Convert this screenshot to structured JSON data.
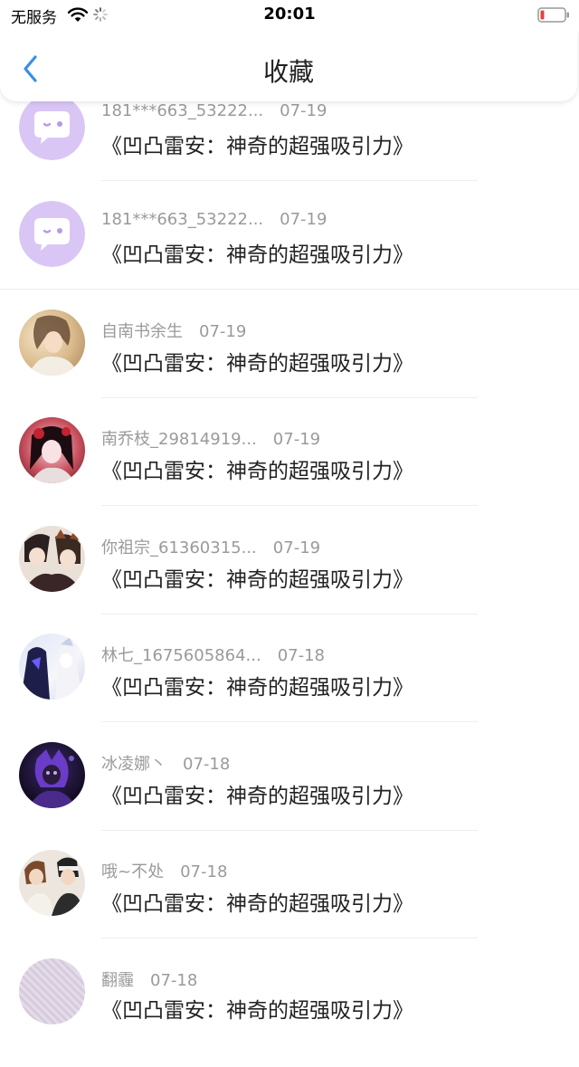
{
  "status_bar": {
    "carrier": "无服务",
    "time": "20:01"
  },
  "nav": {
    "title": "收藏"
  },
  "items": [
    {
      "username": "181***663_53222...",
      "date": "07-19",
      "content": "《凹凸雷安：神奇的超强吸引力》",
      "avatar_type": "default-bubble"
    },
    {
      "username": "181***663_53222...",
      "date": "07-19",
      "content": "《凹凸雷安：神奇的超强吸引力》",
      "avatar_type": "default-bubble"
    },
    {
      "username": "自南书余生",
      "date": "07-19",
      "content": "《凹凸雷安：神奇的超强吸引力》",
      "avatar_type": "photo"
    },
    {
      "username": "南乔枝_29814919...",
      "date": "07-19",
      "content": "《凹凸雷安：神奇的超强吸引力》",
      "avatar_type": "photo"
    },
    {
      "username": "你祖宗_61360315...",
      "date": "07-19",
      "content": "《凹凸雷安：神奇的超强吸引力》",
      "avatar_type": "photo"
    },
    {
      "username": "林七_1675605864...",
      "date": "07-18",
      "content": "《凹凸雷安：神奇的超强吸引力》",
      "avatar_type": "photo"
    },
    {
      "username": "冰凌娜丶",
      "date": "07-18",
      "content": "《凹凸雷安：神奇的超强吸引力》",
      "avatar_type": "photo"
    },
    {
      "username": "哦~不处",
      "date": "07-18",
      "content": "《凹凸雷安：神奇的超强吸引力》",
      "avatar_type": "photo"
    },
    {
      "username": "翻霾",
      "date": "07-18",
      "content": "《凹凸雷安：神奇的超强吸引力》",
      "avatar_type": "photo"
    }
  ],
  "colors": {
    "accent": "#3a8ee6",
    "default_avatar": "#d9c6f5",
    "meta_text": "#9a9a9a",
    "battery_low": "#e0443a"
  }
}
